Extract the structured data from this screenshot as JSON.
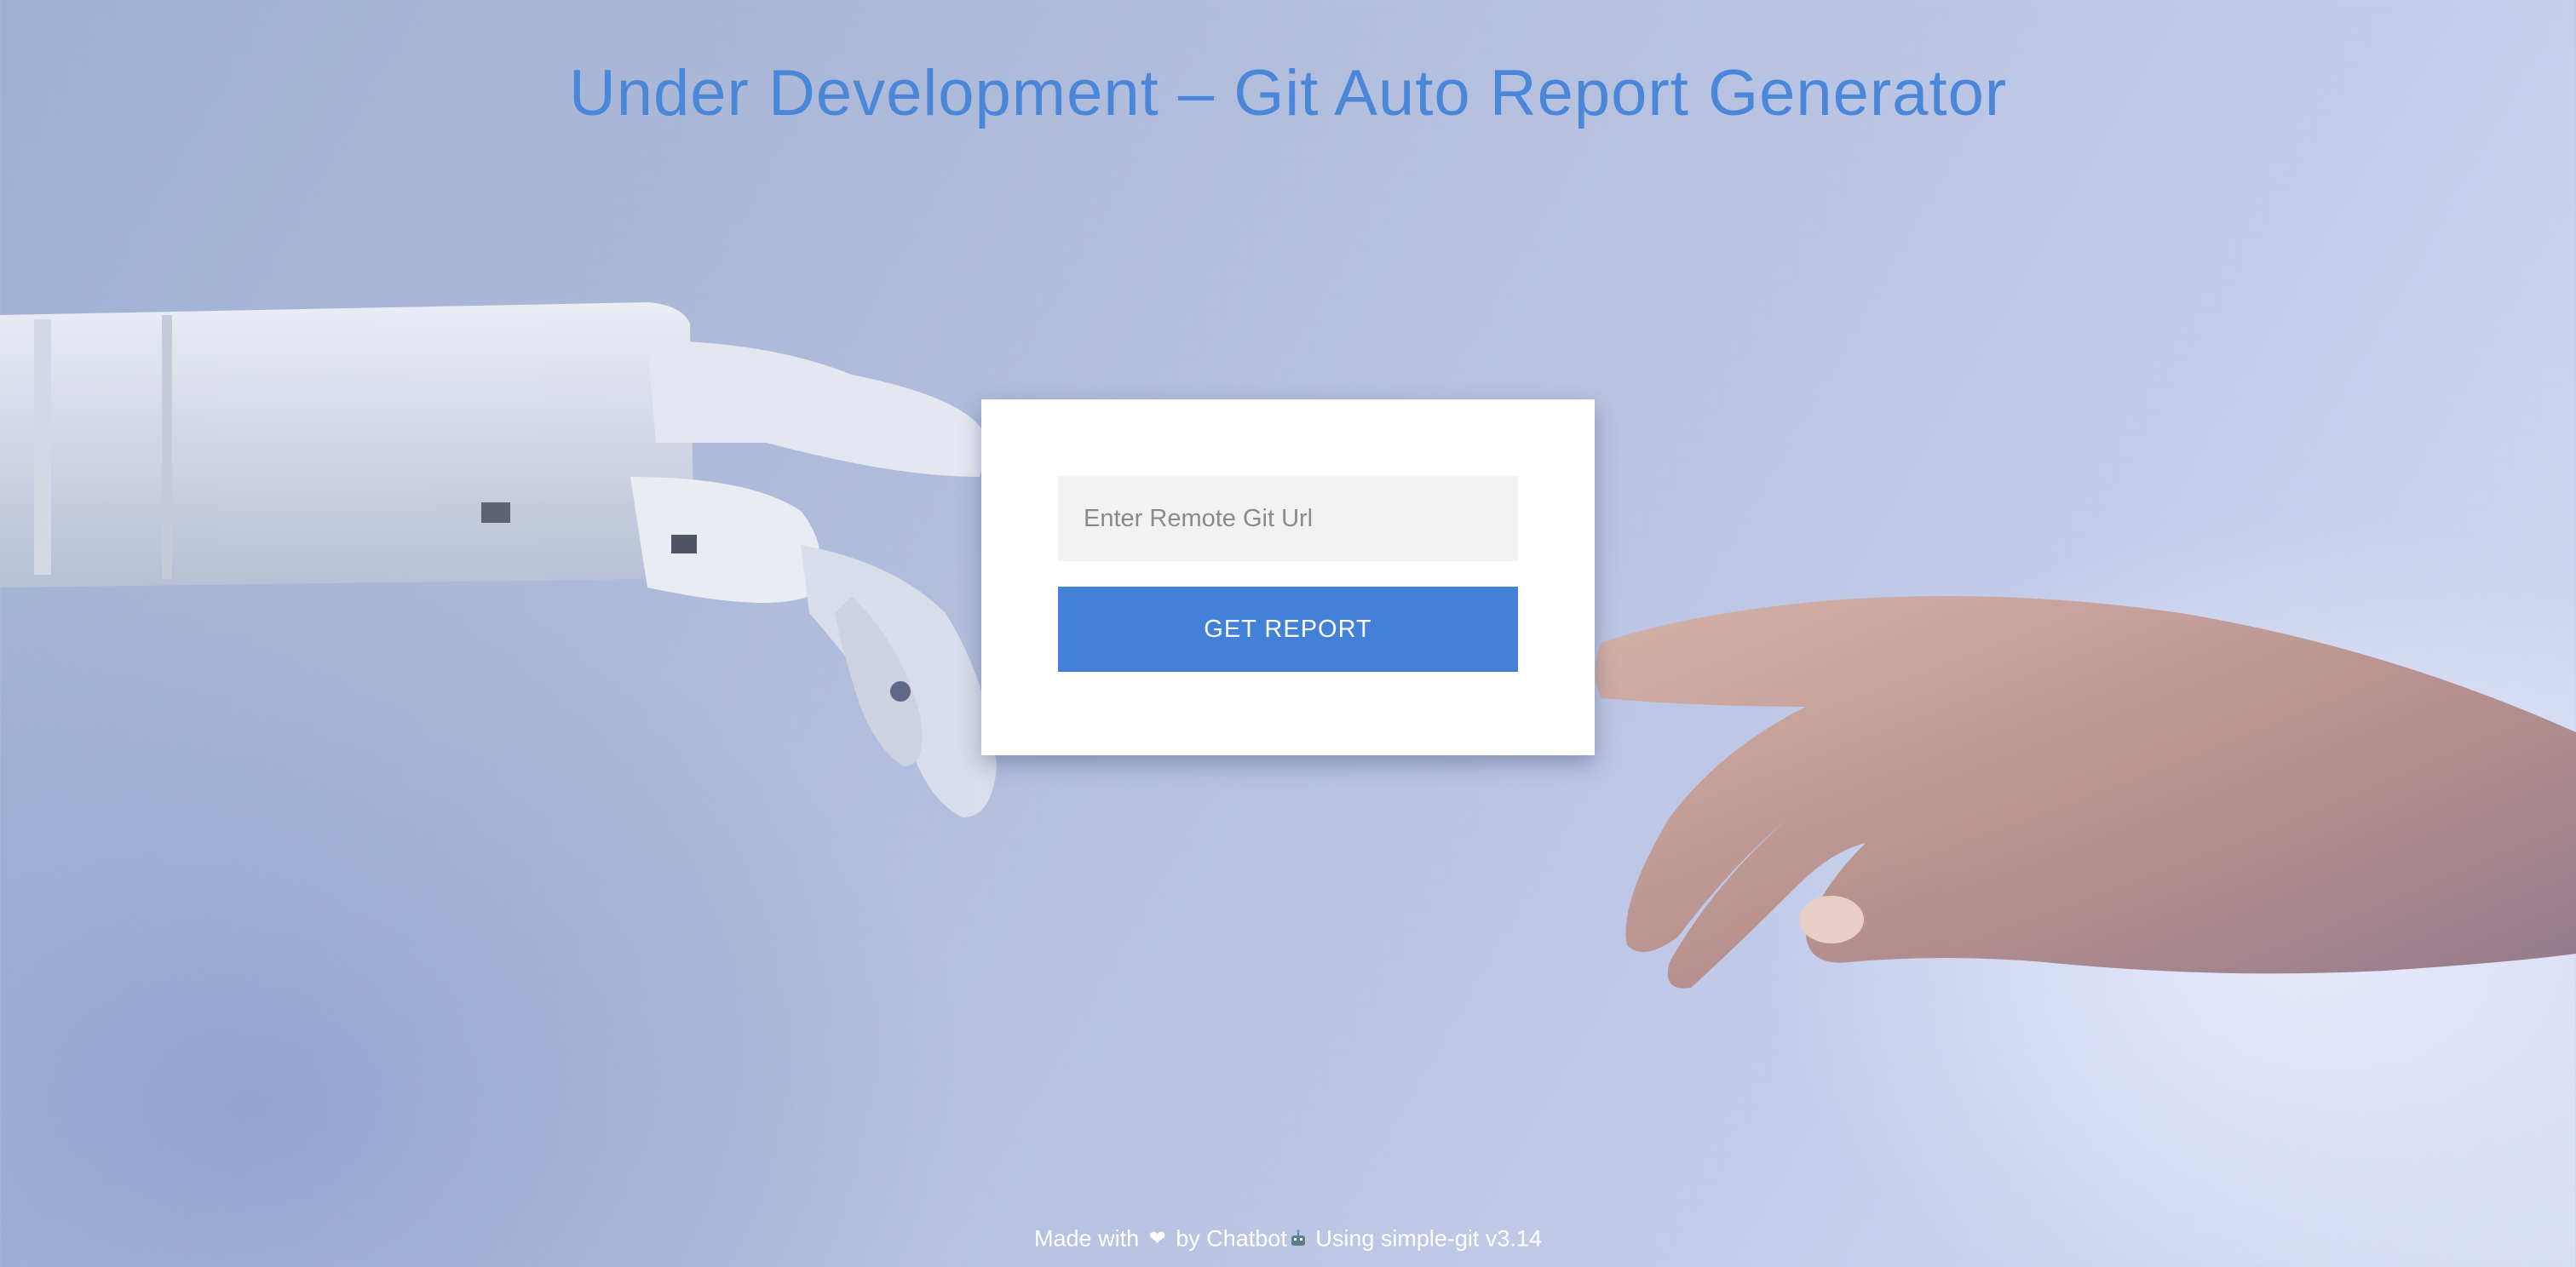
{
  "header": {
    "title": "Under Development – Git Auto Report Generator"
  },
  "form": {
    "url_placeholder": "Enter Remote Git Url",
    "url_value": "",
    "submit_label": "GET REPORT"
  },
  "footer": {
    "made_with": "Made with",
    "heart_icon": "heart-icon",
    "by": "by Chatbot",
    "robot_icon": "robot-icon",
    "using": "Using simple-git v3.14"
  },
  "colors": {
    "accent": "#4281d7",
    "title": "#4a87d8",
    "input_background": "#f2f2f2"
  }
}
